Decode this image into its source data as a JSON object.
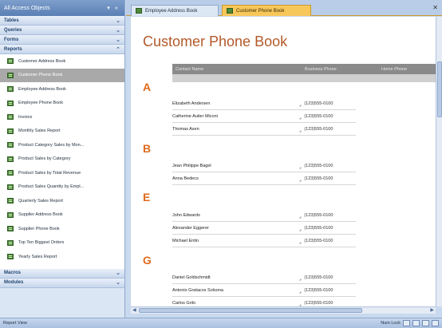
{
  "nav": {
    "header": "All Access Objects",
    "groups_top": [
      {
        "label": "Tables"
      },
      {
        "label": "Queries"
      },
      {
        "label": "Forms"
      },
      {
        "label": "Reports"
      }
    ],
    "report_items": [
      {
        "label": "Customer Address Book",
        "selected": false
      },
      {
        "label": "Customer Phone Book",
        "selected": true
      },
      {
        "label": "Employee Address Book",
        "selected": false
      },
      {
        "label": "Employee Phone Book",
        "selected": false
      },
      {
        "label": "Invoice",
        "selected": false
      },
      {
        "label": "Monthly Sales Report",
        "selected": false
      },
      {
        "label": "Product Category Sales by Mon...",
        "selected": false
      },
      {
        "label": "Product Sales by Category",
        "selected": false
      },
      {
        "label": "Product Sales by Total Revenue",
        "selected": false
      },
      {
        "label": "Product Sales Quantity by Empl...",
        "selected": false
      },
      {
        "label": "Quarterly Sales Report",
        "selected": false
      },
      {
        "label": "Supplier Address Book",
        "selected": false
      },
      {
        "label": "Supplier Phone Book",
        "selected": false
      },
      {
        "label": "Top Ten Biggest Orders",
        "selected": false
      },
      {
        "label": "Yearly Sales Report",
        "selected": false
      }
    ],
    "groups_bottom": [
      {
        "label": "Macros"
      },
      {
        "label": "Modules"
      }
    ]
  },
  "tabs": [
    {
      "label": "Employee Address Book",
      "active": false
    },
    {
      "label": "Customer Phone Book",
      "active": true
    }
  ],
  "report": {
    "title": "Customer Phone Book",
    "columns": [
      "Contact Name",
      "Business Phone",
      "Home Phone"
    ],
    "sections": [
      {
        "letter": "A",
        "rows": [
          {
            "name": "Elizabeth Andersen",
            "phone": "(123)555-0100"
          },
          {
            "name": "Catherine Autier Miconi",
            "phone": "(123)555-0100"
          },
          {
            "name": "Thomas Axen",
            "phone": "(123)555-0100"
          }
        ]
      },
      {
        "letter": "B",
        "rows": [
          {
            "name": "Jean Philippe Bagel",
            "phone": "(123)555-0100"
          },
          {
            "name": "Anna Bedecs",
            "phone": "(123)555-0100"
          }
        ]
      },
      {
        "letter": "E",
        "rows": [
          {
            "name": "John Edwards",
            "phone": "(123)555-0100"
          },
          {
            "name": "Alexander Eggerer",
            "phone": "(123)555-0100"
          },
          {
            "name": "Michael Entin",
            "phone": "(123)555-0100"
          }
        ]
      },
      {
        "letter": "G",
        "rows": [
          {
            "name": "Daniel Goldschmidt",
            "phone": "(123)555-0100"
          },
          {
            "name": "Antonio Gratacos Solsona",
            "phone": "(123)555-0100"
          },
          {
            "name": "Carlos Grilo",
            "phone": "(123)555-0100"
          }
        ]
      }
    ]
  },
  "status": {
    "left": "Report View",
    "right": "Num Lock"
  },
  "colors": {
    "accent": "#f8c75a",
    "title": "#b25a2a",
    "letter": "#e06a1c"
  }
}
